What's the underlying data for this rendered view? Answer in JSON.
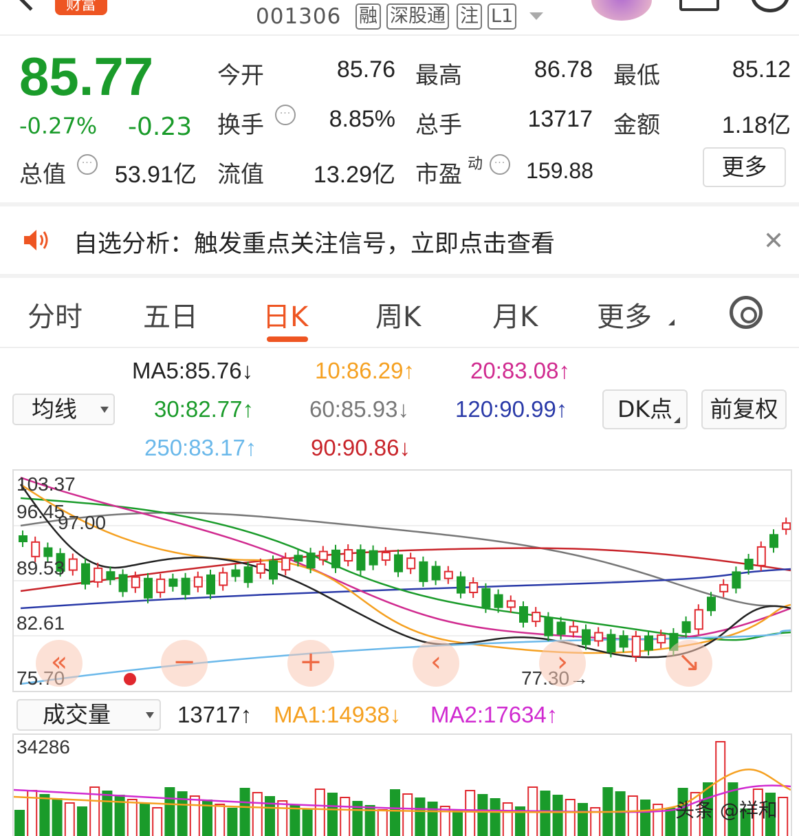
{
  "header": {
    "brand_badge": "财富",
    "stock_code": "001306",
    "tags": [
      "融",
      "深股通",
      "注",
      "L1"
    ]
  },
  "quote": {
    "price": "85.77",
    "change_pct": "-0.27%",
    "change_abs": "-0.23",
    "rows": [
      [
        {
          "label": "今开",
          "value": "85.76",
          "color": "green"
        },
        {
          "label": "最高",
          "value": "86.78",
          "color": "red"
        },
        {
          "label": "最低",
          "value": "85.12",
          "color": "green"
        }
      ],
      [
        {
          "label": "换手",
          "value": "8.85%",
          "color": "dark"
        },
        {
          "label": "总手",
          "value": "13717",
          "color": "dark"
        },
        {
          "label": "金额",
          "value": "1.18亿",
          "color": "dark"
        }
      ]
    ],
    "market_cap_label": "总值",
    "market_cap_value": "53.91亿",
    "float_label": "流值",
    "float_value": "13.29亿",
    "pe_label": "市盈",
    "pe_superscript": "动",
    "pe_value": "159.88",
    "more_label": "更多"
  },
  "notice": {
    "text": "自选分析：触发重点关注信号，立即点击查看"
  },
  "tabs": [
    {
      "label": "分时",
      "active": false
    },
    {
      "label": "五日",
      "active": false
    },
    {
      "label": "日K",
      "active": true
    },
    {
      "label": "周K",
      "active": false
    },
    {
      "label": "月K",
      "active": false
    },
    {
      "label": "更多",
      "active": false
    }
  ],
  "ma_panel": {
    "select_label": "均线",
    "items": [
      {
        "text": "MA5:85.76↓",
        "color": "#222222"
      },
      {
        "text": "10:86.29↑",
        "color": "#f5a020"
      },
      {
        "text": "20:83.08↑",
        "color": "#d02a8f"
      },
      {
        "text": "30:82.77↑",
        "color": "#1a9b2a"
      },
      {
        "text": "60:85.93↓",
        "color": "#777777"
      },
      {
        "text": "120:90.99↑",
        "color": "#2a3aa8"
      },
      {
        "text": "250:83.17↑",
        "color": "#6ab8ea"
      },
      {
        "text": "90:90.86↓",
        "color": "#c8242a"
      }
    ],
    "dk_button": "DK点",
    "adjust_button": "前复权"
  },
  "kline": {
    "y_labels": [
      "103.37",
      "96.45",
      "89.53",
      "82.61",
      "75.70"
    ],
    "high_marker": "97.00",
    "low_marker": "77.30→",
    "nav_buttons": [
      "«",
      "−",
      "+",
      "‹",
      "›",
      "↘"
    ]
  },
  "volume": {
    "select_label": "成交量",
    "current": "13717↑",
    "ma1": "MA1:14938↓",
    "ma2": "MA2:17634↑",
    "max_label": "34286",
    "watermark": "头条 @祥和"
  },
  "colors": {
    "up": "#e0282e",
    "down": "#1a9b2a",
    "accent": "#ee5522"
  }
}
